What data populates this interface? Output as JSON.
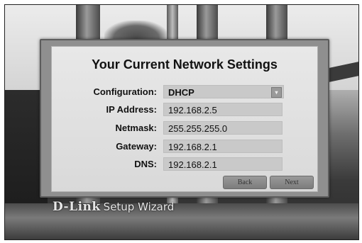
{
  "dialog": {
    "title": "Your Current Network Settings",
    "fields": [
      {
        "label": "Configuration:",
        "value": "DHCP"
      },
      {
        "label": "IP Address:",
        "value": "192.168.2.5"
      },
      {
        "label": "Netmask:",
        "value": "255.255.255.0"
      },
      {
        "label": "Gateway:",
        "value": "192.168.2.1"
      },
      {
        "label": "DNS:",
        "value": "192.168.2.1"
      }
    ],
    "back_label": "Back",
    "next_label": "Next"
  },
  "brand": {
    "logo": "D-Link",
    "caption": "Setup Wizard"
  },
  "icons": {
    "select_arrow": "chevron-down-icon"
  }
}
